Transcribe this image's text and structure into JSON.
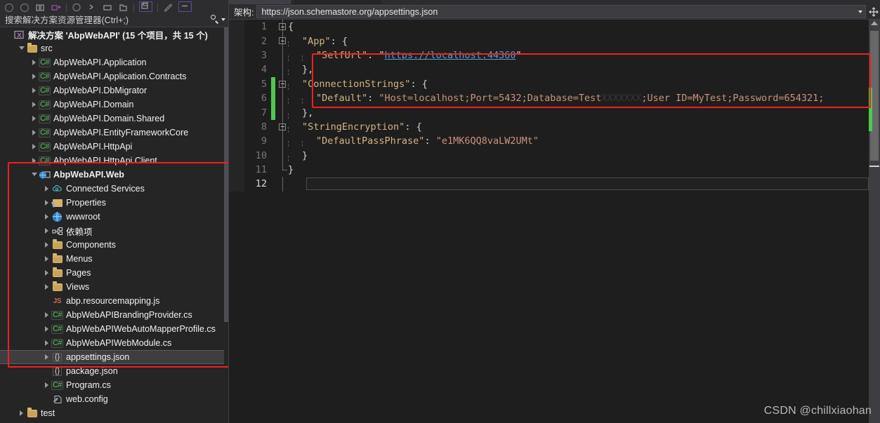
{
  "solution_explorer": {
    "toolbar_icons": [
      "back-arrow-icon",
      "forward-arrow-icon",
      "home-icon",
      "sync-with-active-document-icon",
      "refresh-icon",
      "collapse-all-icon",
      "show-all-files-icon",
      "new-folder-icon",
      "properties-window-icon",
      "preview-selected-items-icon",
      "pending-changes-icon"
    ],
    "search": {
      "placeholder": "搜索解决方案资源管理器(Ctrl+;)",
      "icon": "search-icon",
      "dropdown_icon": "chevron-down-icon"
    },
    "tree": [
      {
        "indent": 0,
        "arrow": "none",
        "icon": "solution-icon",
        "label": "解决方案 'AbpWebAPI' (15 个项目，共 15 个)",
        "bold": true
      },
      {
        "indent": 1,
        "arrow": "expanded",
        "icon": "folder-icon",
        "label": "src"
      },
      {
        "indent": 2,
        "arrow": "collapsed",
        "icon": "csharp-project-icon",
        "label": "AbpWebAPI.Application"
      },
      {
        "indent": 2,
        "arrow": "collapsed",
        "icon": "csharp-project-icon",
        "label": "AbpWebAPI.Application.Contracts"
      },
      {
        "indent": 2,
        "arrow": "collapsed",
        "icon": "csharp-project-icon",
        "label": "AbpWebAPI.DbMigrator"
      },
      {
        "indent": 2,
        "arrow": "collapsed",
        "icon": "csharp-project-icon",
        "label": "AbpWebAPI.Domain"
      },
      {
        "indent": 2,
        "arrow": "collapsed",
        "icon": "csharp-project-icon",
        "label": "AbpWebAPI.Domain.Shared"
      },
      {
        "indent": 2,
        "arrow": "collapsed",
        "icon": "csharp-project-icon",
        "label": "AbpWebAPI.EntityFrameworkCore"
      },
      {
        "indent": 2,
        "arrow": "collapsed",
        "icon": "csharp-project-icon",
        "label": "AbpWebAPI.HttpApi"
      },
      {
        "indent": 2,
        "arrow": "collapsed",
        "icon": "csharp-project-icon",
        "label": "AbpWebAPI.HttpApi.Client"
      },
      {
        "indent": 2,
        "arrow": "expanded",
        "icon": "web-project-icon",
        "label": "AbpWebAPI.Web",
        "bold": true
      },
      {
        "indent": 3,
        "arrow": "collapsed",
        "icon": "connected-services-icon",
        "label": "Connected Services"
      },
      {
        "indent": 3,
        "arrow": "collapsed",
        "icon": "properties-folder-icon",
        "label": "Properties"
      },
      {
        "indent": 3,
        "arrow": "collapsed",
        "icon": "globe-icon",
        "label": "wwwroot"
      },
      {
        "indent": 3,
        "arrow": "collapsed",
        "icon": "dependencies-icon",
        "label": "依赖项"
      },
      {
        "indent": 3,
        "arrow": "collapsed",
        "icon": "folder-icon",
        "label": "Components"
      },
      {
        "indent": 3,
        "arrow": "collapsed",
        "icon": "folder-icon",
        "label": "Menus"
      },
      {
        "indent": 3,
        "arrow": "collapsed",
        "icon": "folder-icon",
        "label": "Pages"
      },
      {
        "indent": 3,
        "arrow": "collapsed",
        "icon": "folder-icon",
        "label": "Views"
      },
      {
        "indent": 3,
        "arrow": "none",
        "icon": "javascript-file-icon",
        "label": "abp.resourcemapping.js"
      },
      {
        "indent": 3,
        "arrow": "collapsed",
        "icon": "csharp-file-icon",
        "label": "AbpWebAPIBrandingProvider.cs"
      },
      {
        "indent": 3,
        "arrow": "collapsed",
        "icon": "csharp-file-icon",
        "label": "AbpWebAPIWebAutoMapperProfile.cs"
      },
      {
        "indent": 3,
        "arrow": "collapsed",
        "icon": "csharp-file-icon",
        "label": "AbpWebAPIWebModule.cs"
      },
      {
        "indent": 3,
        "arrow": "collapsed",
        "icon": "json-file-icon",
        "label": "appsettings.json",
        "selected": true
      },
      {
        "indent": 3,
        "arrow": "none",
        "icon": "json-file-icon",
        "label": "package.json"
      },
      {
        "indent": 3,
        "arrow": "collapsed",
        "icon": "csharp-file-icon",
        "label": "Program.cs"
      },
      {
        "indent": 3,
        "arrow": "none",
        "icon": "config-file-icon",
        "label": "web.config"
      },
      {
        "indent": 1,
        "arrow": "collapsed",
        "icon": "folder-icon",
        "label": "test"
      }
    ]
  },
  "editor": {
    "schema_label": "架构:",
    "schema_value": "https://json.schemastore.org/appsettings.json",
    "schema_dropdown_icon": "chevron-down-icon",
    "split_view_icon": "split-view-icon",
    "total_lines": 12,
    "current_line": 12,
    "lines": [
      {
        "n": 1,
        "fold": "box",
        "indent": 0,
        "changed": false,
        "tokens": [
          {
            "t": "{",
            "c": "punc"
          }
        ]
      },
      {
        "n": 2,
        "fold": "box",
        "indent": 1,
        "changed": false,
        "tokens": [
          {
            "t": "\"App\"",
            "c": "prop"
          },
          {
            "t": ": {",
            "c": "punc"
          }
        ]
      },
      {
        "n": 3,
        "fold": "none",
        "indent": 2,
        "changed": false,
        "tokens": [
          {
            "t": "\"SelfUrl\"",
            "c": "prop"
          },
          {
            "t": ": \"",
            "c": "punc"
          },
          {
            "t": "https://localhost:44360",
            "c": "link"
          },
          {
            "t": "\"",
            "c": "punc"
          }
        ]
      },
      {
        "n": 4,
        "fold": "none",
        "indent": 1,
        "changed": false,
        "tokens": [
          {
            "t": "},",
            "c": "punc"
          }
        ]
      },
      {
        "n": 5,
        "fold": "box",
        "indent": 1,
        "changed": true,
        "tokens": [
          {
            "t": "\"ConnectionStrings\"",
            "c": "prop"
          },
          {
            "t": ": {",
            "c": "punc"
          }
        ]
      },
      {
        "n": 6,
        "fold": "none",
        "indent": 2,
        "changed": true,
        "tokens": [
          {
            "t": "\"Default\"",
            "c": "prop"
          },
          {
            "t": ": ",
            "c": "punc"
          },
          {
            "t": "\"Host=localhost;Port=5432;Database=Test",
            "c": "str"
          },
          {
            "t": "XXXXXXX",
            "c": "dim"
          },
          {
            "t": ";User ID=MyTest;Password=654321;",
            "c": "str"
          }
        ]
      },
      {
        "n": 7,
        "fold": "none",
        "indent": 1,
        "changed": true,
        "tokens": [
          {
            "t": "},",
            "c": "punc"
          }
        ]
      },
      {
        "n": 8,
        "fold": "box",
        "indent": 1,
        "changed": false,
        "tokens": [
          {
            "t": "\"StringEncryption\"",
            "c": "prop"
          },
          {
            "t": ": {",
            "c": "punc"
          }
        ]
      },
      {
        "n": 9,
        "fold": "none",
        "indent": 2,
        "changed": false,
        "tokens": [
          {
            "t": "\"DefaultPassPhrase\"",
            "c": "prop"
          },
          {
            "t": ": ",
            "c": "punc"
          },
          {
            "t": "\"e1MK6QQ8vaLW2UMt\"",
            "c": "str"
          }
        ]
      },
      {
        "n": 10,
        "fold": "none",
        "indent": 1,
        "changed": false,
        "tokens": [
          {
            "t": "}",
            "c": "punc"
          }
        ]
      },
      {
        "n": 11,
        "fold": "end",
        "indent": 0,
        "changed": false,
        "tokens": [
          {
            "t": "}",
            "c": "punc"
          }
        ]
      },
      {
        "n": 12,
        "fold": "none",
        "indent": 0,
        "changed": false,
        "cursor": true,
        "tokens": []
      }
    ]
  },
  "annotations": {
    "highlight_color": "#f41e1e",
    "sidebar_box_label": "web-project-highlight",
    "editor_box_label": "connection-strings-highlight"
  },
  "watermark": "CSDN @chillxiaohan"
}
